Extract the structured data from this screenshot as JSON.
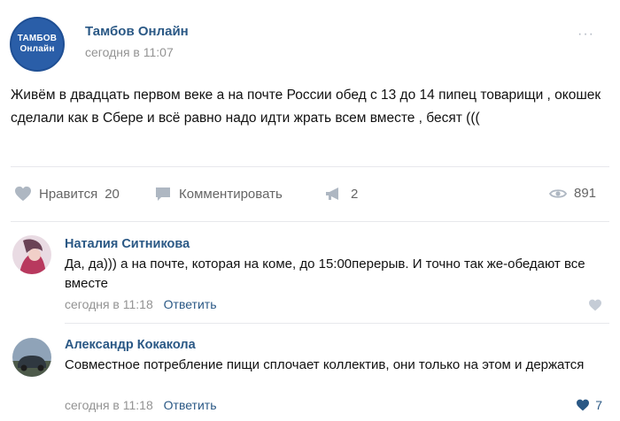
{
  "post": {
    "group_avatar_line1": "ТАМБОВ",
    "group_avatar_line2": "Онлайн",
    "group_name": "Тамбов Онлайн",
    "time": "сегодня в 11:07",
    "more": "···",
    "text": "Живём в двадцать первом веке а на почте России обед с 13 до 14 пипец товарищи , окошек сделали как в Сбере и всё равно надо идти жрать всем вместе , бесят (((",
    "like_label": "Нравится",
    "like_count": "20",
    "comment_label": "Комментировать",
    "share_count": "2",
    "views": "891"
  },
  "comments": [
    {
      "author": "Наталия Ситникова",
      "text": "Да, да))) а на почте, которая на коме, до 15:00перерыв. И точно так же-обедают все вместе",
      "time": "сегодня в 11:18",
      "reply": "Ответить",
      "likes": ""
    },
    {
      "author": "Александр Кокакола",
      "text": "Совместное потребление пищи сплочает коллектив, они только на этом и держатся",
      "time": "сегодня в 11:18",
      "reply": "Ответить",
      "likes": "7"
    }
  ],
  "colors": {
    "link": "#2a5885",
    "muted": "#939393",
    "icon": "#aeb7c2",
    "brand": "#2a5ea8"
  }
}
